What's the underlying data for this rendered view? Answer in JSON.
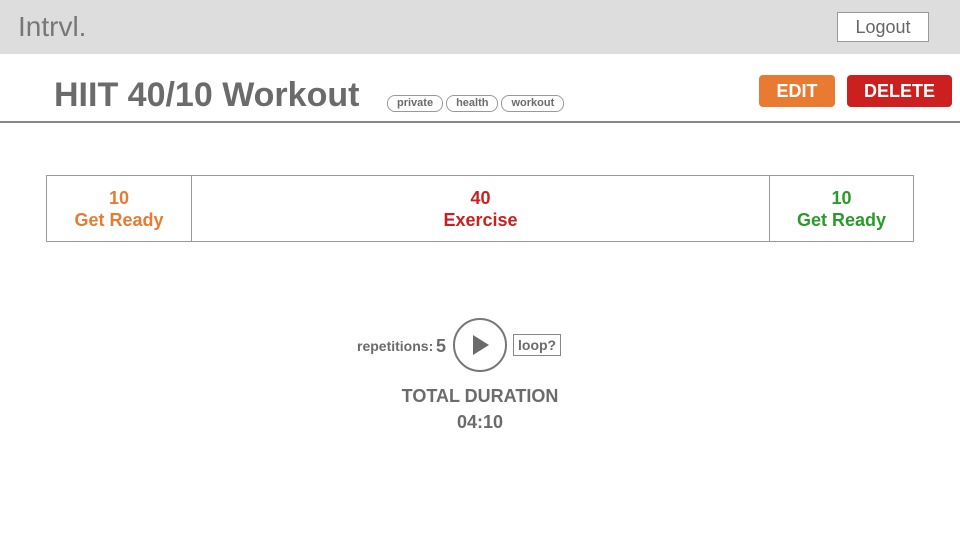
{
  "app": {
    "brand": "Intrvl.",
    "logout_label": "Logout"
  },
  "workout": {
    "title": "HIIT 40/10 Workout",
    "tags": [
      "private",
      "health",
      "workout"
    ],
    "edit_label": "EDIT",
    "delete_label": "DELETE"
  },
  "intervals": [
    {
      "seconds": "10",
      "label": "Get Ready",
      "color": "#e87b31"
    },
    {
      "seconds": "40",
      "label": "Exercise",
      "color": "#cc1f1f"
    },
    {
      "seconds": "10",
      "label": "Get Ready",
      "color": "#2a9a2a"
    }
  ],
  "controls": {
    "repetitions_label": "repetitions:",
    "repetitions_value": "5",
    "play_icon": "play-icon",
    "loop_label": "loop?"
  },
  "summary": {
    "total_label": "TOTAL DURATION",
    "total_value": "04:10"
  },
  "colors": {
    "edit": "#e87b31",
    "delete": "#cc1f1f",
    "topbar": "#dddddd"
  }
}
